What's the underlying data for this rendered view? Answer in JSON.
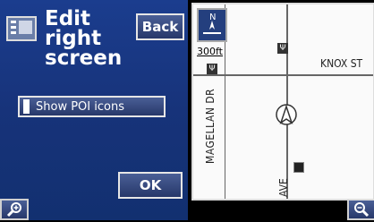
{
  "header": {
    "title_lines": [
      "Edit",
      "right",
      "screen"
    ],
    "back_label": "Back"
  },
  "options": {
    "show_poi_label": "Show POI icons"
  },
  "ok_label": "OK",
  "map": {
    "scale_label": "300ft",
    "streets": [
      "KNOX ST",
      "MAGELLAN DR",
      "AVE"
    ]
  },
  "colors": {
    "panel_bg": "#17337a",
    "button_bg": "#27386a",
    "map_bg": "#fafafa"
  },
  "icons": [
    "menu-grid-icon",
    "north-arrow-icon",
    "restaurant-icon",
    "vehicle-position-icon",
    "zoom-in-icon",
    "zoom-out-icon"
  ]
}
